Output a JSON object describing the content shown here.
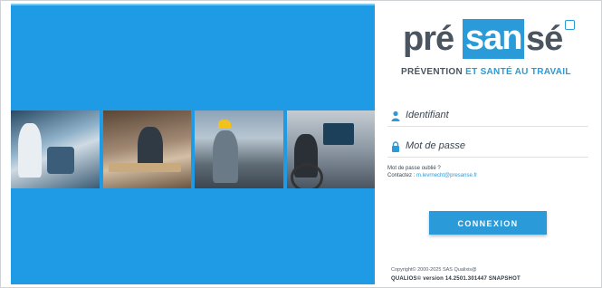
{
  "brand": {
    "logo_pre": "pré",
    "logo_mid": "san",
    "logo_post": "sé",
    "tagline_a": "PRÉVENTION",
    "tagline_b": "ET SANTÉ AU TRAVAIL"
  },
  "login": {
    "identifiant_label": "Identifiant",
    "password_label": "Mot de passe",
    "forgot_text": "Mot de passe oublié ?",
    "contact_prefix": "Contactez :",
    "contact_email": "m.levrnecht@presanse.fr",
    "submit_label": "CONNEXION"
  },
  "footer": {
    "copyright": "Copyright© 2000-2025 SAS Qualixis@",
    "version": "QUALIOS© version 14.2501.301447 SNAPSHOT"
  },
  "colors": {
    "accent": "#2a9ad8",
    "panel": "#1f9be6",
    "text": "#4a5560"
  },
  "icons": {
    "user": "user-icon",
    "lock": "lock-icon"
  }
}
